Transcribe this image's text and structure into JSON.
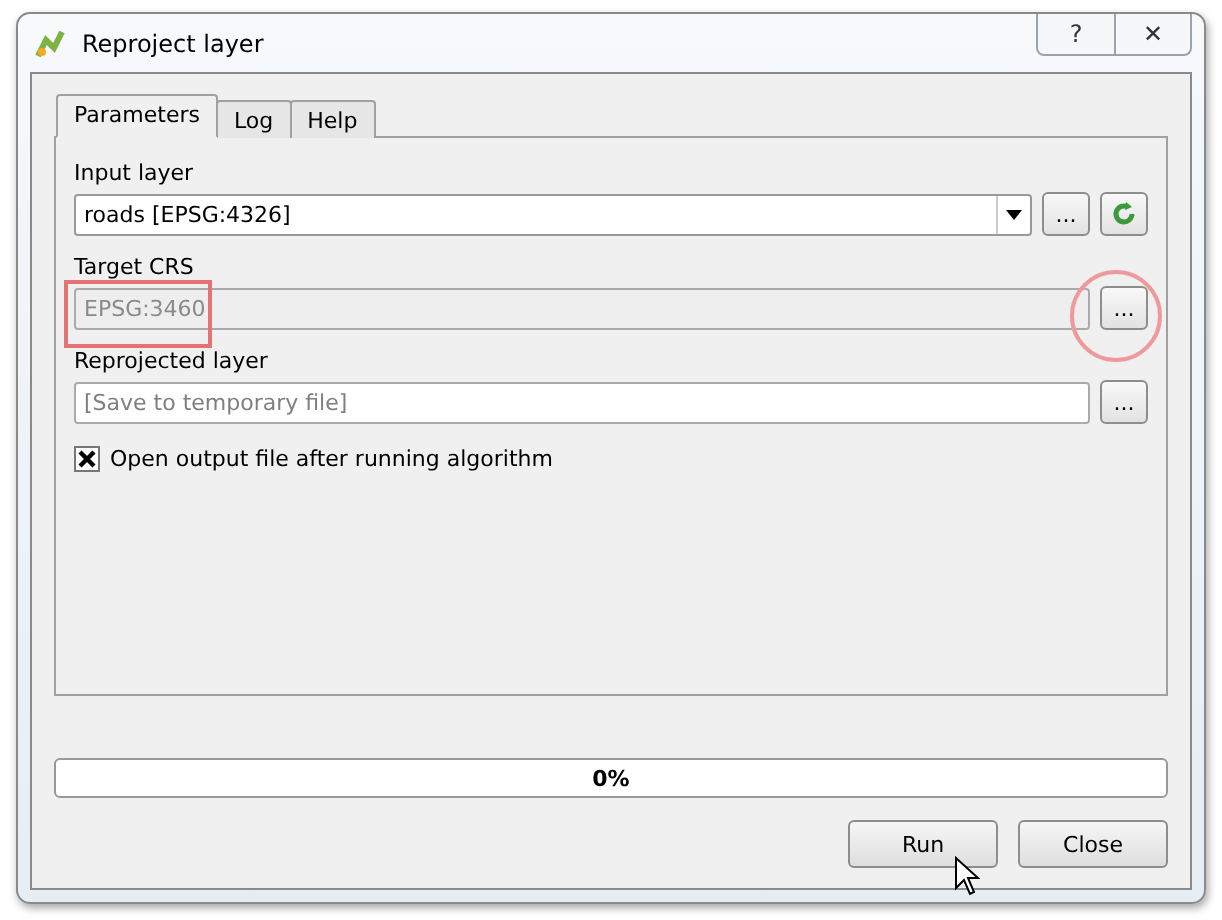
{
  "window": {
    "title": "Reproject layer",
    "controls": [
      "?",
      "✕"
    ]
  },
  "tabs": [
    {
      "label": "Parameters",
      "selected": true
    },
    {
      "label": "Log",
      "selected": false
    },
    {
      "label": "Help",
      "selected": false
    }
  ],
  "parameters": [
    {
      "kind": "combo",
      "label": "Input layer",
      "value": "roads [EPSG:4326]",
      "disabled": false,
      "button": "...",
      "refresh": true
    },
    {
      "kind": "text",
      "label": "Target CRS",
      "value": "EPSG:3460",
      "disabled": true,
      "button": "..."
    },
    {
      "kind": "text",
      "label": "Reprojected layer",
      "placeholder": "[Save to temporary file]",
      "disabled": false,
      "button": "..."
    },
    {
      "kind": "checkbox",
      "label": "Open output file after running algorithm",
      "checked": true
    }
  ],
  "progress": {
    "level": 0,
    "text": "0%"
  },
  "buttons": [
    "Run",
    "Close"
  ]
}
